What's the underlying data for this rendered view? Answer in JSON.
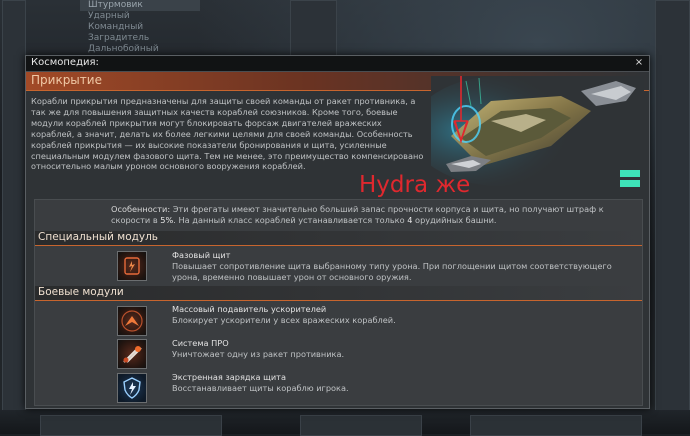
{
  "background": {
    "menu_items": [
      "Штурмовик",
      "Ударный",
      "Командный",
      "Заградитель",
      "Дальнобойный"
    ]
  },
  "dialog": {
    "title": "Космопедия:",
    "close_label": "×",
    "header": "Прикрытие",
    "intro": "Корабли прикрытия предназначены для защиты своей команды от ракет противника, а так же для повышения защитных качеств кораблей союзников. Кроме того, боевые модули кораблей прикрытия могут блокировать форсаж двигателей вражеских кораблей, а значит, делать их более легкими целями для своей команды. Особенность кораблей прикрытия — их высокие показатели бронирования и щита, усиленные специальным модулем фазового щита. Тем не менее, это преимущество компенсировано относительно малым уроном основного вооружения кораблей.",
    "overlay_text": "Hydra же",
    "features": {
      "label": "Особенности:",
      "text_1": " Эти фрегаты имеют значительно больший запас прочности корпуса и щита, но получают штраф к скорости в ",
      "bold_1": "5%",
      "text_2": ". На данный класс кораблей устанавливается только ",
      "bold_2": "4",
      "text_3": " орудийных башни."
    },
    "special_section": {
      "title": "Специальный модуль",
      "modules": [
        {
          "name": "Фазовый щит",
          "icon": "phase-shield-icon",
          "description": "Повышает сопротивление щита выбранному типу урона. При поглощении щитом соответствующего урона, временно повышает урон от основного оружия."
        }
      ]
    },
    "combat_section": {
      "title": "Боевые модули",
      "modules": [
        {
          "name": "Массовый подавитель ускорителей",
          "icon": "afterburner-suppressor-icon",
          "description": "Блокирует ускорители у всех вражеских кораблей."
        },
        {
          "name": "Система ПРО",
          "icon": "missile-defense-icon",
          "description": "Уничтожает одну из ракет противника."
        },
        {
          "name": "Экстренная зарядка щита",
          "icon": "shield-recharge-icon",
          "description": "Восстанавливает щиты кораблю игрока."
        }
      ]
    }
  },
  "colors": {
    "accent_orange": "#c7652e",
    "overlay_red": "#e0282e",
    "menu_icon": "#3ee3b8"
  }
}
